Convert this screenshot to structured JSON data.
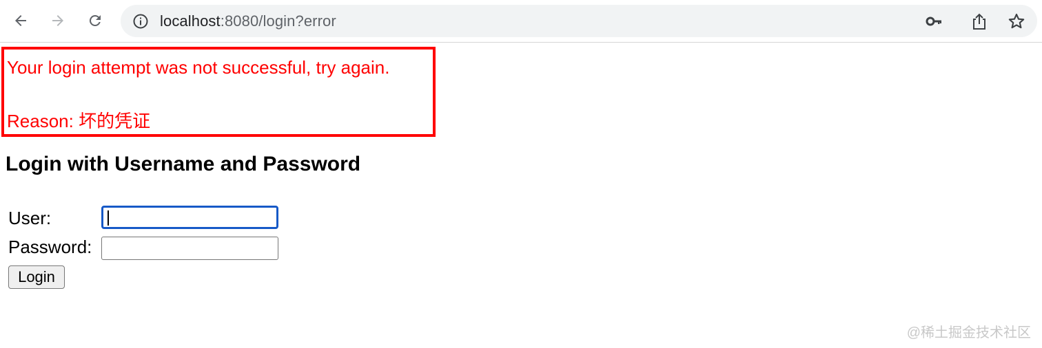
{
  "browser": {
    "url_host": "localhost",
    "url_rest": ":8080/login?error",
    "icons": {
      "back": "arrow-left-icon",
      "forward": "arrow-right-icon",
      "reload": "reload-icon",
      "site_info": "info-icon",
      "password": "key-icon",
      "share": "share-icon",
      "bookmark": "star-icon"
    }
  },
  "error": {
    "message": "Your login attempt was not successful, try again.",
    "reason": "Reason: 坏的凭证",
    "color": "#ff0000"
  },
  "form": {
    "heading": "Login with Username and Password",
    "user_label": "User:",
    "password_label": "Password:",
    "user_value": "",
    "password_value": "",
    "submit_label": "Login"
  },
  "watermark": "@稀土掘金技术社区"
}
